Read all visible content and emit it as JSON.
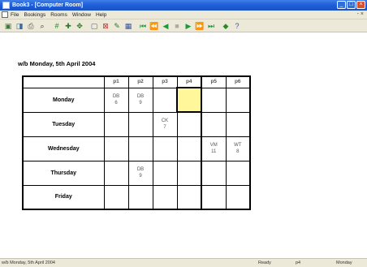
{
  "window": {
    "title": "Book3 - [Computer Room]"
  },
  "menu": {
    "items": [
      "File",
      "Bookings",
      "Rooms",
      "Window",
      "Help"
    ]
  },
  "toolbar": {
    "icons": [
      "open-icon",
      "save-icon",
      "print-icon",
      "search-icon",
      "grid-icon",
      "add-icon",
      "move-icon",
      "page-icon",
      "close-book-icon",
      "edit-icon",
      "chart-icon",
      "first-icon",
      "rewind-icon",
      "previous-icon",
      "stop-icon",
      "next-icon",
      "fast-forward-icon",
      "last-icon",
      "help-icon",
      "whats-this-icon"
    ]
  },
  "schedule": {
    "week_label": "w/b Monday, 5th April 2004",
    "periods": [
      "p1",
      "p2",
      "p3",
      "p4",
      "p5",
      "p6"
    ],
    "days": [
      {
        "name": "Monday",
        "slots": [
          "DB\n6",
          "DB\n9",
          "",
          "",
          "",
          ""
        ],
        "selected_index": 3
      },
      {
        "name": "Tuesday",
        "slots": [
          "",
          "",
          "CK\n7",
          "",
          "",
          ""
        ]
      },
      {
        "name": "Wednesday",
        "slots": [
          "",
          "",
          "",
          "",
          "VM\n11",
          "WT\n8"
        ]
      },
      {
        "name": "Thursday",
        "slots": [
          "",
          "DB\n9",
          "",
          "",
          "",
          ""
        ]
      },
      {
        "name": "Friday",
        "slots": [
          "",
          "",
          "",
          "",
          "",
          ""
        ]
      }
    ]
  },
  "status": {
    "date": "w/b Monday, 5th April 2004",
    "state": "Ready",
    "period": "p4",
    "day": "Monday"
  },
  "colors": {
    "selected_cell": "#fff79a",
    "titlebar": "#1f5fd8",
    "chrome": "#ece9d8"
  }
}
